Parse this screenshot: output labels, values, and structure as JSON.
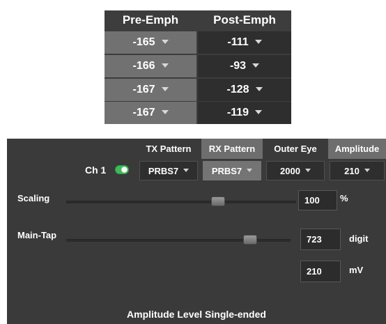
{
  "emphasis_table": {
    "headers": {
      "pre": "Pre-Emph",
      "post": "Post-Emph"
    },
    "rows": [
      {
        "pre": "-165",
        "post": "-111"
      },
      {
        "pre": "-166",
        "post": "-93"
      },
      {
        "pre": "-167",
        "post": "-128"
      },
      {
        "pre": "-167",
        "post": "-119"
      }
    ]
  },
  "channel": {
    "label": "Ch 1",
    "toggle_on": true,
    "toggle_color": "#3dbb5a",
    "columns": [
      {
        "header": "TX Pattern",
        "value": "PRBS7"
      },
      {
        "header": "RX Pattern",
        "value": "PRBS7"
      },
      {
        "header": "Outer Eye",
        "value": "2000"
      },
      {
        "header": "Amplitude",
        "value": "210"
      }
    ]
  },
  "scaling": {
    "label": "Scaling",
    "value": "100",
    "unit": "%",
    "slider_fraction": 0.66
  },
  "main_tap": {
    "label": "Main-Tap",
    "value": "723",
    "unit": "digit",
    "value2": "210",
    "unit2": "mV",
    "slider_fraction": 0.82
  },
  "footer": {
    "text": "Amplitude Level Single-ended"
  },
  "icons": {
    "dropdown": "caret-down-icon",
    "toggle": "toggle-switch-icon"
  }
}
